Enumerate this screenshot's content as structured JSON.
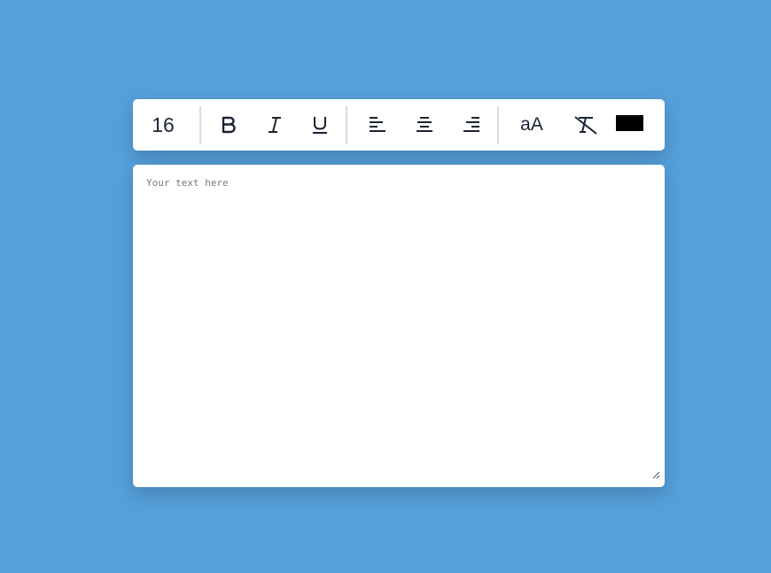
{
  "toolbar": {
    "font_size": "16",
    "buttons": [
      {
        "name": "bold-button",
        "icon": "bold-icon"
      },
      {
        "name": "italic-button",
        "icon": "italic-icon"
      },
      {
        "name": "underline-button",
        "icon": "underline-icon"
      },
      {
        "name": "align-left-button",
        "icon": "align-left-icon"
      },
      {
        "name": "align-center-button",
        "icon": "align-center-icon"
      },
      {
        "name": "align-right-button",
        "icon": "align-right-icon"
      },
      {
        "name": "change-case-button",
        "label": "aA"
      },
      {
        "name": "clear-format-button",
        "icon": "remove-format-icon"
      }
    ],
    "text_color": "#000000"
  },
  "editor": {
    "placeholder": "Your text here",
    "value": ""
  },
  "colors": {
    "background": "#559fdb",
    "icon": "#1c2433"
  }
}
